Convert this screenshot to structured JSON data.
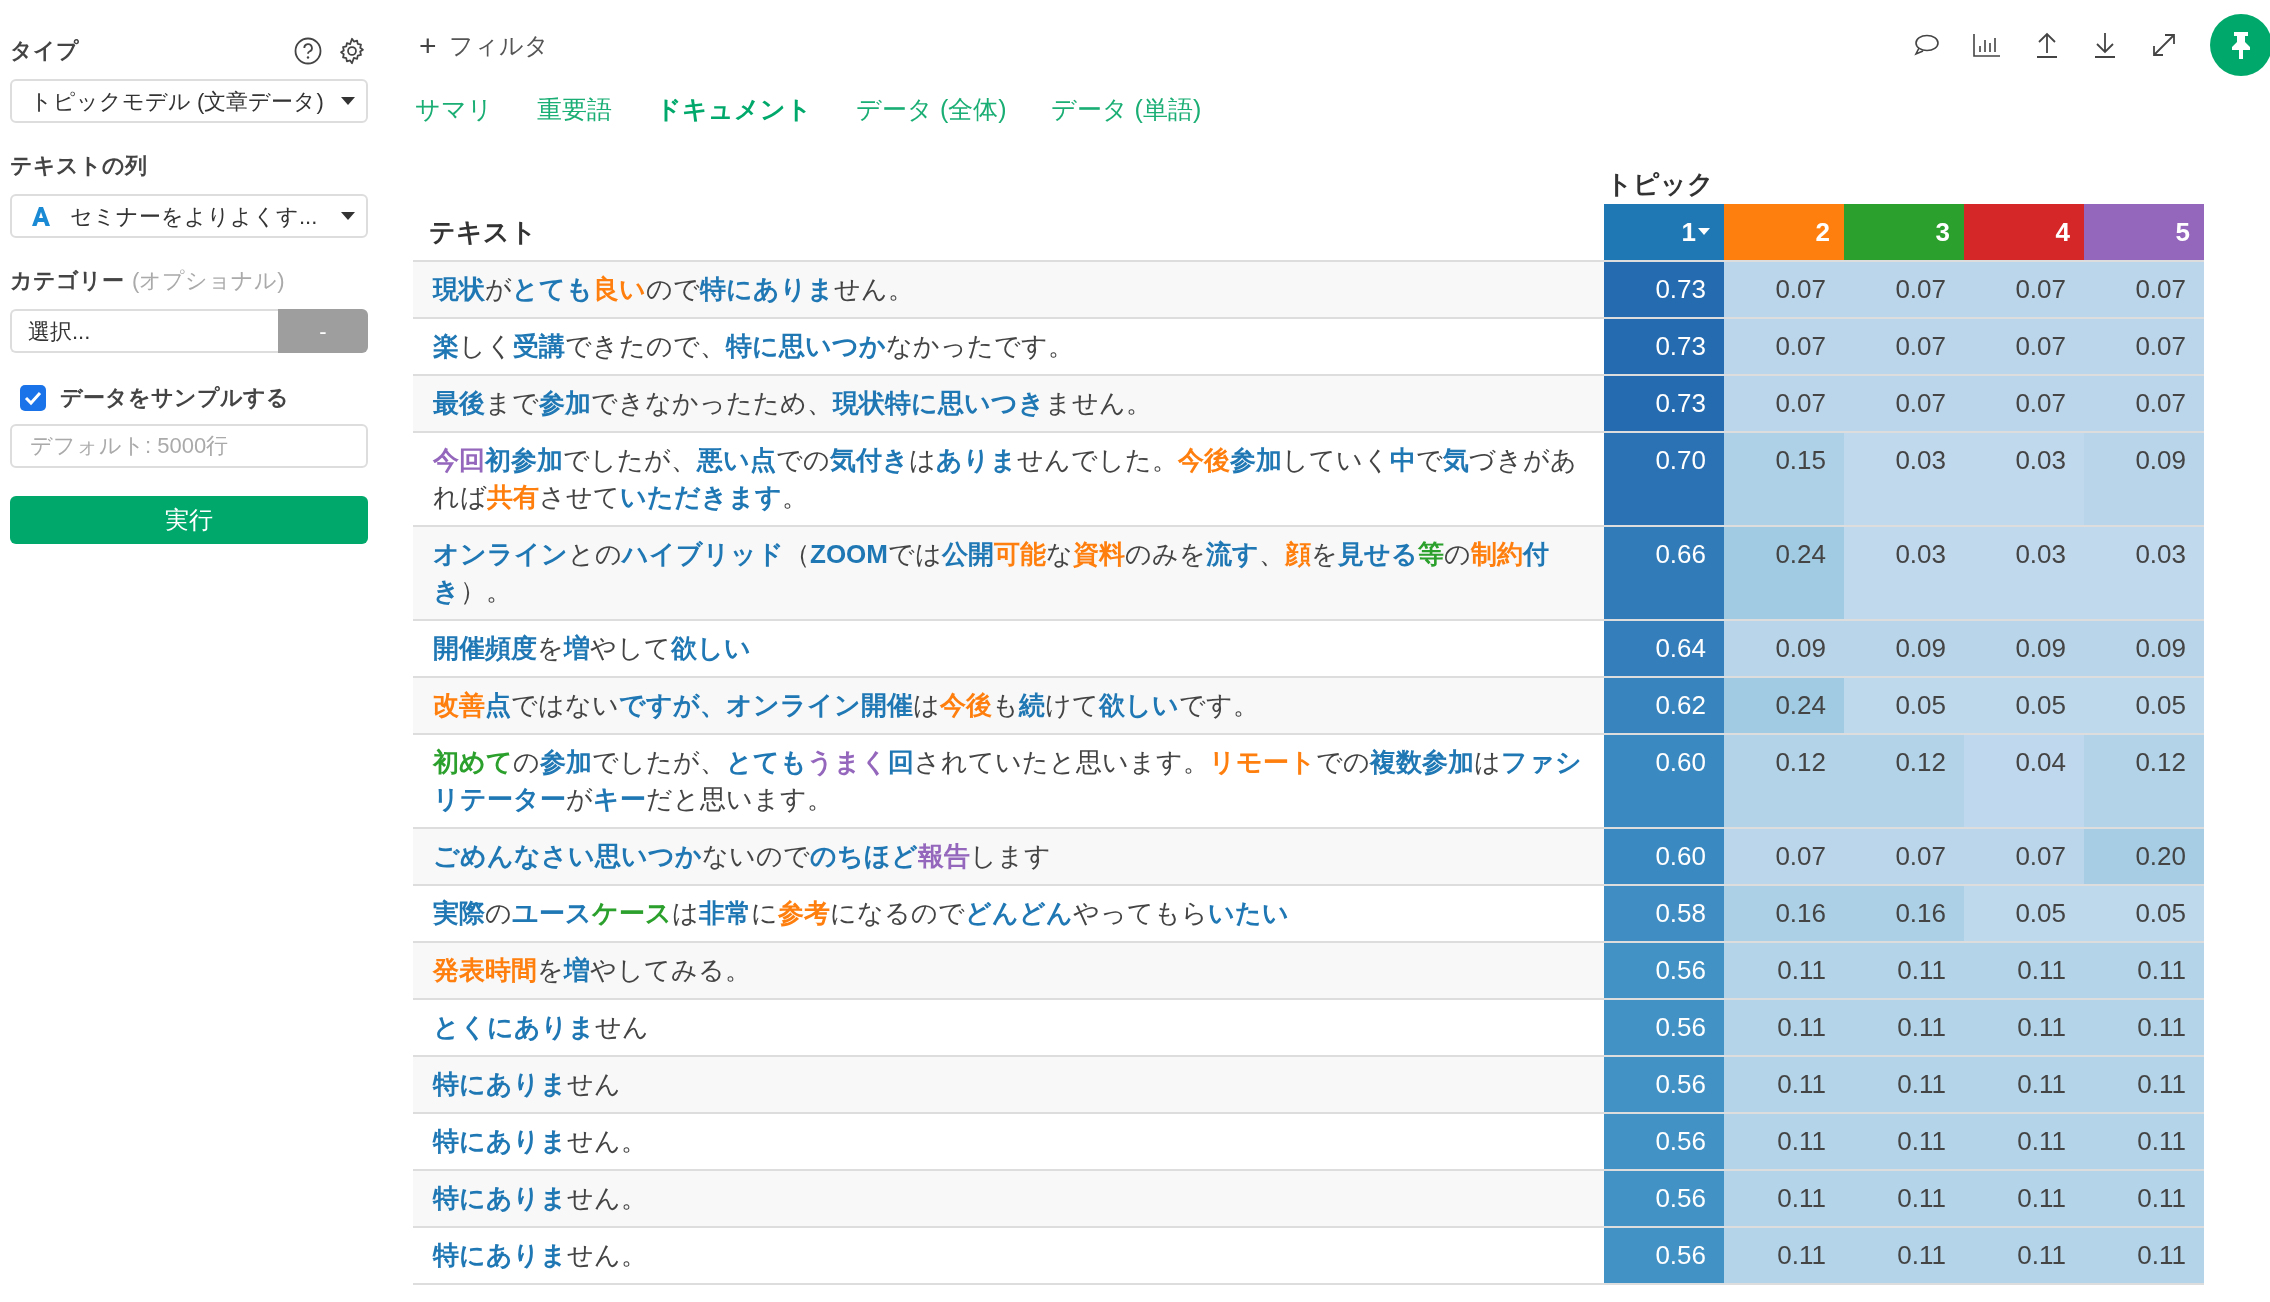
{
  "sidebar": {
    "type_label": "タイプ",
    "type_value": "トピックモデル (文章データ)",
    "text_column_label": "テキストの列",
    "text_column_value": "セミナーをよりよくす...",
    "category_label": "カテゴリー",
    "category_optional": "(オプショナル)",
    "category_value": "選択...",
    "category_button": "-",
    "sample_label": "データをサンプルする",
    "sample_checked": true,
    "sample_placeholder": "デフォルト: 5000行",
    "run_button": "実行"
  },
  "toolbar": {
    "filter": "フィルタ",
    "filter_icon": "+"
  },
  "tabs": [
    {
      "label": "サマリ",
      "selected": false
    },
    {
      "label": "重要語",
      "selected": false
    },
    {
      "label": "ドキュメント",
      "selected": true
    },
    {
      "label": "データ (全体)",
      "selected": false
    },
    {
      "label": "データ (単語)",
      "selected": false
    }
  ],
  "table": {
    "topic_group": "トピック",
    "text_column": "テキスト",
    "topics": [
      {
        "label": "1",
        "color": "#1f77b4",
        "sorted": true
      },
      {
        "label": "2",
        "color": "#ff7f0e",
        "sorted": false
      },
      {
        "label": "3",
        "color": "#2ca02c",
        "sorted": false
      },
      {
        "label": "4",
        "color": "#d62728",
        "sorted": false
      },
      {
        "label": "5",
        "color": "#9467bd",
        "sorted": false
      }
    ],
    "rows": [
      {
        "segments": [
          {
            "text": "現状",
            "color": "#1f77b4"
          },
          {
            "text": "が"
          },
          {
            "text": "とても",
            "color": "#1f77b4"
          },
          {
            "text": "良い",
            "color": "#ff7f0e"
          },
          {
            "text": "ので"
          },
          {
            "text": "特にありま",
            "color": "#1f77b4"
          },
          {
            "text": "せん。"
          }
        ],
        "values": [
          "0.73",
          "0.07",
          "0.07",
          "0.07",
          "0.07"
        ]
      },
      {
        "segments": [
          {
            "text": "楽",
            "color": "#1f77b4"
          },
          {
            "text": "しく"
          },
          {
            "text": "受講",
            "color": "#1f77b4"
          },
          {
            "text": "できたので、"
          },
          {
            "text": "特に思いつか",
            "color": "#1f77b4"
          },
          {
            "text": "なかったです。"
          }
        ],
        "values": [
          "0.73",
          "0.07",
          "0.07",
          "0.07",
          "0.07"
        ]
      },
      {
        "segments": [
          {
            "text": "最後",
            "color": "#1f77b4"
          },
          {
            "text": "まで"
          },
          {
            "text": "参加",
            "color": "#1f77b4"
          },
          {
            "text": "できなかったため、"
          },
          {
            "text": "現状特に思いつき",
            "color": "#1f77b4"
          },
          {
            "text": "ません。"
          }
        ],
        "values": [
          "0.73",
          "0.07",
          "0.07",
          "0.07",
          "0.07"
        ]
      },
      {
        "segments": [
          {
            "text": "今回",
            "color": "#9467bd"
          },
          {
            "text": "初参加",
            "color": "#1f77b4"
          },
          {
            "text": "でしたが、"
          },
          {
            "text": "悪い点",
            "color": "#1f77b4"
          },
          {
            "text": "での"
          },
          {
            "text": "気付き",
            "color": "#1f77b4"
          },
          {
            "text": "は"
          },
          {
            "text": "ありま",
            "color": "#1f77b4"
          },
          {
            "text": "せんでした。"
          },
          {
            "text": "今後",
            "color": "#ff7f0e"
          },
          {
            "text": "参加",
            "color": "#1f77b4"
          },
          {
            "text": "していく"
          },
          {
            "text": "中",
            "color": "#1f77b4"
          },
          {
            "text": "で"
          },
          {
            "text": "気",
            "color": "#1f77b4"
          },
          {
            "text": "づきがあれば"
          },
          {
            "text": "共有",
            "color": "#ff7f0e"
          },
          {
            "text": "させて"
          },
          {
            "text": "いただきます",
            "color": "#1f77b4"
          },
          {
            "text": "。"
          }
        ],
        "values": [
          "0.70",
          "0.15",
          "0.03",
          "0.03",
          "0.09"
        ]
      },
      {
        "segments": [
          {
            "text": "オンライン",
            "color": "#1f77b4"
          },
          {
            "text": "との"
          },
          {
            "text": "ハイブリッド",
            "color": "#1f77b4"
          },
          {
            "text": "（"
          },
          {
            "text": "ZOOM",
            "color": "#1f77b4"
          },
          {
            "text": "では"
          },
          {
            "text": "公開",
            "color": "#1f77b4"
          },
          {
            "text": "可能",
            "color": "#ff7f0e"
          },
          {
            "text": "な"
          },
          {
            "text": "資料",
            "color": "#ff7f0e"
          },
          {
            "text": "のみを"
          },
          {
            "text": "流す",
            "color": "#1f77b4"
          },
          {
            "text": "、"
          },
          {
            "text": "顔",
            "color": "#ff7f0e"
          },
          {
            "text": "を"
          },
          {
            "text": "見せる",
            "color": "#1f77b4"
          },
          {
            "text": "等",
            "color": "#2ca02c"
          },
          {
            "text": "の"
          },
          {
            "text": "制約",
            "color": "#ff7f0e"
          },
          {
            "text": "付き",
            "color": "#1f77b4"
          },
          {
            "text": "）。"
          }
        ],
        "values": [
          "0.66",
          "0.24",
          "0.03",
          "0.03",
          "0.03"
        ]
      },
      {
        "segments": [
          {
            "text": "開催頻度",
            "color": "#1f77b4"
          },
          {
            "text": "を"
          },
          {
            "text": "増",
            "color": "#1f77b4"
          },
          {
            "text": "やして"
          },
          {
            "text": "欲しい",
            "color": "#1f77b4"
          }
        ],
        "values": [
          "0.64",
          "0.09",
          "0.09",
          "0.09",
          "0.09"
        ]
      },
      {
        "segments": [
          {
            "text": "改善",
            "color": "#ff7f0e"
          },
          {
            "text": "点",
            "color": "#1f77b4"
          },
          {
            "text": "ではない"
          },
          {
            "text": "ですが、オンライン開催",
            "color": "#1f77b4"
          },
          {
            "text": "は"
          },
          {
            "text": "今後",
            "color": "#ff7f0e"
          },
          {
            "text": "も"
          },
          {
            "text": "続",
            "color": "#1f77b4"
          },
          {
            "text": "けて"
          },
          {
            "text": "欲しい",
            "color": "#1f77b4"
          },
          {
            "text": "です。"
          }
        ],
        "values": [
          "0.62",
          "0.24",
          "0.05",
          "0.05",
          "0.05"
        ]
      },
      {
        "segments": [
          {
            "text": "初めて",
            "color": "#2ca02c"
          },
          {
            "text": "の"
          },
          {
            "text": "参加",
            "color": "#1f77b4"
          },
          {
            "text": "でしたが、"
          },
          {
            "text": "とても",
            "color": "#1f77b4"
          },
          {
            "text": "うまく",
            "color": "#9467bd"
          },
          {
            "text": "回",
            "color": "#1f77b4"
          },
          {
            "text": "されていたと思います。"
          },
          {
            "text": "リモート",
            "color": "#ff7f0e"
          },
          {
            "text": "での"
          },
          {
            "text": "複数参加",
            "color": "#1f77b4"
          },
          {
            "text": "は"
          },
          {
            "text": "ファシリテーター",
            "color": "#1f77b4"
          },
          {
            "text": "が"
          },
          {
            "text": "キー",
            "color": "#1f77b4"
          },
          {
            "text": "だと思います。"
          }
        ],
        "values": [
          "0.60",
          "0.12",
          "0.12",
          "0.04",
          "0.12"
        ]
      },
      {
        "segments": [
          {
            "text": "ごめんなさい思いつか",
            "color": "#1f77b4"
          },
          {
            "text": "ないので"
          },
          {
            "text": "のちほど",
            "color": "#1f77b4"
          },
          {
            "text": "報告",
            "color": "#9467bd"
          },
          {
            "text": "します"
          }
        ],
        "values": [
          "0.60",
          "0.07",
          "0.07",
          "0.07",
          "0.20"
        ]
      },
      {
        "segments": [
          {
            "text": "実際",
            "color": "#1f77b4"
          },
          {
            "text": "の"
          },
          {
            "text": "ユース",
            "color": "#1f77b4"
          },
          {
            "text": "ケース",
            "color": "#2ca02c"
          },
          {
            "text": "は"
          },
          {
            "text": "非常",
            "color": "#1f77b4"
          },
          {
            "text": "に"
          },
          {
            "text": "参考",
            "color": "#ff7f0e"
          },
          {
            "text": "になるので"
          },
          {
            "text": "どんどん",
            "color": "#1f77b4"
          },
          {
            "text": "やってもら"
          },
          {
            "text": "いたい",
            "color": "#1f77b4"
          }
        ],
        "values": [
          "0.58",
          "0.16",
          "0.16",
          "0.05",
          "0.05"
        ]
      },
      {
        "segments": [
          {
            "text": "発表時間",
            "color": "#ff7f0e"
          },
          {
            "text": "を"
          },
          {
            "text": "増",
            "color": "#1f77b4"
          },
          {
            "text": "やしてみる。"
          }
        ],
        "values": [
          "0.56",
          "0.11",
          "0.11",
          "0.11",
          "0.11"
        ]
      },
      {
        "segments": [
          {
            "text": "とくにありま",
            "color": "#1f77b4"
          },
          {
            "text": "せん"
          }
        ],
        "values": [
          "0.56",
          "0.11",
          "0.11",
          "0.11",
          "0.11"
        ]
      },
      {
        "segments": [
          {
            "text": "特にありま",
            "color": "#1f77b4"
          },
          {
            "text": "せん"
          }
        ],
        "values": [
          "0.56",
          "0.11",
          "0.11",
          "0.11",
          "0.11"
        ]
      },
      {
        "segments": [
          {
            "text": "特にありま",
            "color": "#1f77b4"
          },
          {
            "text": "せん。"
          }
        ],
        "values": [
          "0.56",
          "0.11",
          "0.11",
          "0.11",
          "0.11"
        ]
      },
      {
        "segments": [
          {
            "text": "特にありま",
            "color": "#1f77b4"
          },
          {
            "text": "せん。"
          }
        ],
        "values": [
          "0.56",
          "0.11",
          "0.11",
          "0.11",
          "0.11"
        ]
      },
      {
        "segments": [
          {
            "text": "特にありま",
            "color": "#1f77b4"
          },
          {
            "text": "せん。"
          }
        ],
        "values": [
          "0.56",
          "0.11",
          "0.11",
          "0.11",
          "0.11"
        ]
      }
    ]
  }
}
